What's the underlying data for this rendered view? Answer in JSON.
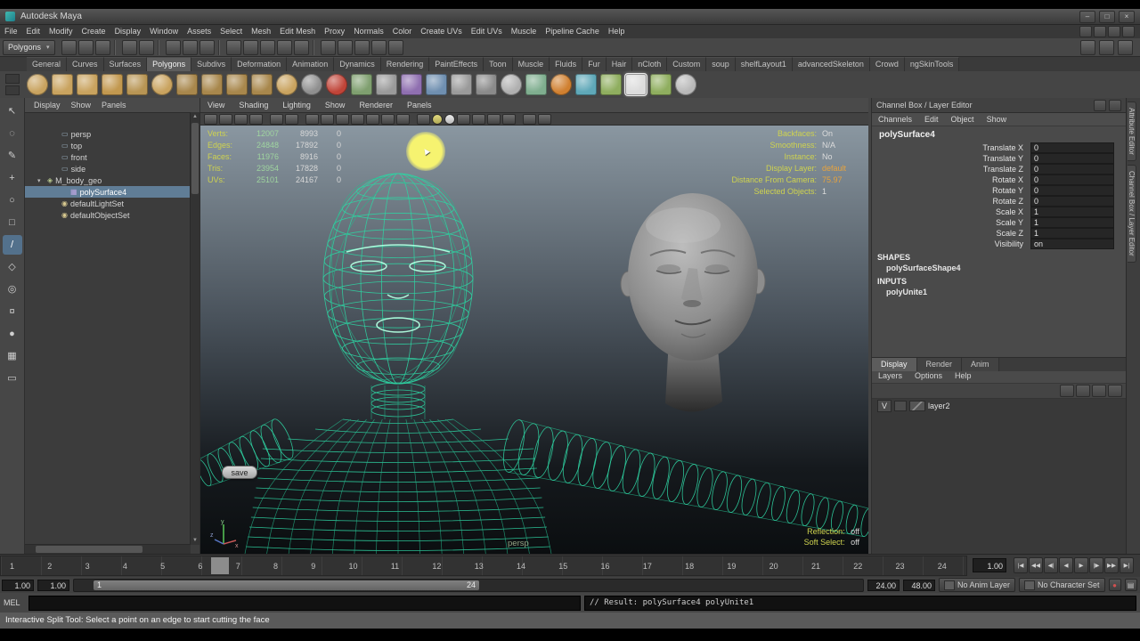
{
  "window": {
    "title": "Autodesk Maya",
    "controls": [
      "–",
      "□",
      "×"
    ]
  },
  "menu_bar": [
    "File",
    "Edit",
    "Modify",
    "Create",
    "Display",
    "Window",
    "Assets",
    "Select",
    "Mesh",
    "Edit Mesh",
    "Proxy",
    "Normals",
    "Color",
    "Create UVs",
    "Edit UVs",
    "Muscle",
    "Pipeline Cache",
    "Help"
  ],
  "status_line": {
    "menu_set": "Polygons",
    "icons": [
      {
        "name": "new-scene"
      },
      {
        "name": "open-scene"
      },
      {
        "name": "save-scene"
      },
      {
        "name": "separator",
        "cls": "sep"
      },
      {
        "name": "undo"
      },
      {
        "name": "redo"
      },
      {
        "name": "separator",
        "cls": "sep"
      },
      {
        "name": "select-by-hierarchy"
      },
      {
        "name": "select-by-object"
      },
      {
        "name": "select-by-component"
      },
      {
        "name": "separator",
        "cls": "sep"
      },
      {
        "name": "snap-to-grid"
      },
      {
        "name": "snap-to-curve"
      },
      {
        "name": "snap-to-point"
      },
      {
        "name": "snap-to-view-plane"
      },
      {
        "name": "make-live"
      },
      {
        "name": "separator",
        "cls": "sep"
      },
      {
        "name": "construction-history"
      },
      {
        "name": "open-render-view"
      },
      {
        "name": "render-current-frame"
      },
      {
        "name": "ipr-render"
      },
      {
        "name": "render-settings"
      }
    ],
    "right_icons": [
      {
        "name": "show-attribute-editor"
      },
      {
        "name": "show-tool-settings"
      },
      {
        "name": "show-channel-box"
      }
    ]
  },
  "shelf": {
    "tabs": [
      {
        "label": "General"
      },
      {
        "label": "Curves"
      },
      {
        "label": "Surfaces"
      },
      {
        "label": "Polygons",
        "cls": "active"
      },
      {
        "label": "Subdivs"
      },
      {
        "label": "Deformation"
      },
      {
        "label": "Animation"
      },
      {
        "label": "Dynamics"
      },
      {
        "label": "Rendering"
      },
      {
        "label": "PaintEffects"
      },
      {
        "label": "Toon"
      },
      {
        "label": "Muscle"
      },
      {
        "label": "Fluids"
      },
      {
        "label": "Fur"
      },
      {
        "label": "Hair"
      },
      {
        "label": "nCloth"
      },
      {
        "label": "Custom"
      },
      {
        "label": "soup"
      },
      {
        "label": "shelfLayout1"
      },
      {
        "label": "advancedSkeleton"
      },
      {
        "label": "Crowd"
      },
      {
        "label": "ngSkinTools"
      }
    ],
    "icons": [
      {
        "name": "poly-sphere",
        "color": "#c9a35f",
        "cls": "round"
      },
      {
        "name": "poly-cube",
        "color": "#c9a35f"
      },
      {
        "name": "poly-cylinder",
        "color": "#c9a35f"
      },
      {
        "name": "poly-cone",
        "color": "#c2984f"
      },
      {
        "name": "poly-plane",
        "color": "#b89554"
      },
      {
        "name": "poly-torus",
        "color": "#c9a35f",
        "cls": "round"
      },
      {
        "name": "poly-prism",
        "color": "#a8874c"
      },
      {
        "name": "poly-pyramid",
        "color": "#a8874c"
      },
      {
        "name": "poly-pipe",
        "color": "#a8874c"
      },
      {
        "name": "poly-helix",
        "color": "#a8874c"
      },
      {
        "name": "poly-soccer-ball",
        "color": "#c9a35f",
        "cls": "round"
      },
      {
        "name": "poly-platonic",
        "color": "#8f8f8f",
        "cls": "round"
      },
      {
        "name": "smooth",
        "color": "#c04438",
        "cls": "round"
      },
      {
        "name": "add-divisions",
        "color": "#7f9f6f"
      },
      {
        "name": "extrude",
        "color": "#9a9a9a"
      },
      {
        "name": "bevel",
        "color": "#8f6fb0"
      },
      {
        "name": "bridge",
        "color": "#6f8fb0"
      },
      {
        "name": "combine",
        "color": "#9a9a9a"
      },
      {
        "name": "separate",
        "color": "#8a8a8a"
      },
      {
        "name": "boolean-union",
        "color": "#b0b0b0",
        "cls": "round"
      },
      {
        "name": "mirror-geometry",
        "color": "#7fae8f"
      },
      {
        "name": "merge-vertices",
        "color": "#d08030",
        "cls": "round"
      },
      {
        "name": "target-weld",
        "color": "#5fa8b8"
      },
      {
        "name": "insert-edge-loop",
        "color": "#8fae5f"
      },
      {
        "name": "interactive-split-tool",
        "color": "#dcdcdc",
        "cls": "active"
      },
      {
        "name": "offset-edge-loop",
        "color": "#8fae5f"
      },
      {
        "name": "sculpt-geometry",
        "color": "#b8b8b8",
        "cls": "round"
      }
    ]
  },
  "toolbox": [
    {
      "name": "select-tool",
      "glyph": "↖"
    },
    {
      "name": "lasso-tool",
      "glyph": "◌"
    },
    {
      "name": "paint-select-tool",
      "glyph": "✎"
    },
    {
      "name": "move-tool",
      "glyph": "+"
    },
    {
      "name": "rotate-tool",
      "glyph": "○"
    },
    {
      "name": "scale-tool",
      "glyph": "□"
    },
    {
      "name": "interactive-split-tool-slot",
      "glyph": "/",
      "cls": "active"
    },
    {
      "name": "show-manipulator-tool",
      "glyph": "◇"
    },
    {
      "name": "soft-modification-tool",
      "glyph": "◎"
    },
    {
      "name": "universal-manipulator",
      "glyph": "¤"
    },
    {
      "name": "sculpt-tool",
      "glyph": "●"
    },
    {
      "name": "select-similar-tool",
      "glyph": "▦"
    },
    {
      "name": "layout-single-pane",
      "glyph": "▭"
    }
  ],
  "outliner": {
    "menus": [
      "Display",
      "Show",
      "Panels"
    ],
    "items": [
      {
        "label": "persp",
        "icon": "▭",
        "cls": "cam",
        "indent": 30
      },
      {
        "label": "top",
        "icon": "▭",
        "cls": "cam",
        "indent": 30
      },
      {
        "label": "front",
        "icon": "▭",
        "cls": "cam",
        "indent": 30
      },
      {
        "label": "side",
        "icon": "▭",
        "cls": "cam",
        "indent": 30
      },
      {
        "label": "M_body_geo",
        "icon": "◈",
        "cls": "geo",
        "indent": 14,
        "arrow": "▾"
      },
      {
        "label": "polySurface4",
        "icon": "▦",
        "cls": "mesh selected",
        "indent": 40
      },
      {
        "label": "defaultLightSet",
        "icon": "◉",
        "cls": "set",
        "indent": 30
      },
      {
        "label": "defaultObjectSet",
        "icon": "◉",
        "cls": "set",
        "indent": 30
      }
    ]
  },
  "viewport": {
    "menus": [
      "View",
      "Shading",
      "Lighting",
      "Show",
      "Renderer",
      "Panels"
    ],
    "toolbar_icons": [
      {
        "name": "select-camera"
      },
      {
        "name": "lock-camera"
      },
      {
        "name": "camera-attributes"
      },
      {
        "name": "bookmarks"
      },
      {
        "name": "separator",
        "cls": "sep"
      },
      {
        "name": "image-plane"
      },
      {
        "name": "two-d-pan-zoom"
      },
      {
        "name": "separator",
        "cls": "sep"
      },
      {
        "name": "grid"
      },
      {
        "name": "film-gate"
      },
      {
        "name": "resolution-gate"
      },
      {
        "name": "gate-mask"
      },
      {
        "name": "field-chart"
      },
      {
        "name": "safe-action"
      },
      {
        "name": "safe-title"
      },
      {
        "name": "separator",
        "cls": "sep"
      },
      {
        "name": "wireframe-mode"
      },
      {
        "name": "smooth-shade-mode",
        "cls": "round",
        "color": "#ddd46a"
      },
      {
        "name": "textured-mode",
        "cls": "round",
        "color": "#e8e8e8"
      },
      {
        "name": "use-all-lights"
      },
      {
        "name": "shadows"
      },
      {
        "name": "screen-space-ao"
      },
      {
        "name": "motion-blur"
      },
      {
        "name": "separator",
        "cls": "sep"
      },
      {
        "name": "xray"
      },
      {
        "name": "isolate-select"
      }
    ],
    "hud_left": [
      {
        "label": "Verts:",
        "a": "12007",
        "b": "8993",
        "c": "0"
      },
      {
        "label": "Edges:",
        "a": "24848",
        "b": "17892",
        "c": "0"
      },
      {
        "label": "Faces:",
        "a": "11976",
        "b": "8916",
        "c": "0"
      },
      {
        "label": "Tris:",
        "a": "23954",
        "b": "17828",
        "c": "0"
      },
      {
        "label": "UVs:",
        "a": "25101",
        "b": "24167",
        "c": "0"
      }
    ],
    "hud_right": [
      {
        "label": "Backfaces:",
        "value": "On"
      },
      {
        "label": "Smoothness:",
        "value": "N/A"
      },
      {
        "label": "Instance:",
        "value": "No"
      },
      {
        "label": "Display Layer:",
        "value": "default",
        "cls": "orange"
      },
      {
        "label": "Distance From Camera:",
        "value": "75.97",
        "cls": "orange"
      },
      {
        "label": "Selected Objects:",
        "value": "1"
      }
    ],
    "hud_bottom_right": [
      {
        "label": "Reflection:",
        "value": "off"
      },
      {
        "label": "Soft Select:",
        "value": "off"
      }
    ],
    "camera_label": "persp",
    "save_label": "save",
    "axis": {
      "x": "x",
      "y": "y",
      "z": "z"
    }
  },
  "channel_box": {
    "dock_title": "Channel Box / Layer Editor",
    "menus": [
      "Channels",
      "Edit",
      "Object",
      "Show"
    ],
    "object_name": "polySurface4",
    "attributes": [
      {
        "name": "Translate X",
        "value": "0"
      },
      {
        "name": "Translate Y",
        "value": "0"
      },
      {
        "name": "Translate Z",
        "value": "0"
      },
      {
        "name": "Rotate X",
        "value": "0"
      },
      {
        "name": "Rotate Y",
        "value": "0"
      },
      {
        "name": "Rotate Z",
        "value": "0"
      },
      {
        "name": "Scale X",
        "value": "1"
      },
      {
        "name": "Scale Y",
        "value": "1"
      },
      {
        "name": "Scale Z",
        "value": "1"
      },
      {
        "name": "Visibility",
        "value": "on"
      }
    ],
    "shapes_heading": "SHAPES",
    "shape_name": "polySurfaceShape4",
    "inputs_heading": "INPUTS",
    "input_name": "polyUnite1"
  },
  "layer_editor": {
    "tabs": [
      {
        "label": "Display",
        "cls": "active"
      },
      {
        "label": "Render"
      },
      {
        "label": "Anim"
      }
    ],
    "menus": [
      "Layers",
      "Options",
      "Help"
    ],
    "layers": [
      {
        "visibility": "V",
        "name": "layer2"
      }
    ]
  },
  "dock_tabs": [
    {
      "label": "Attribute Editor"
    },
    {
      "label": "Channel Box / Layer Editor"
    }
  ],
  "timeline": {
    "ticks": [
      "1",
      "2",
      "3",
      "4",
      "5",
      "6",
      "7",
      "8",
      "9",
      "10",
      "11",
      "12",
      "13",
      "14",
      "15",
      "16",
      "17",
      "18",
      "19",
      "20",
      "21",
      "22",
      "23",
      "24"
    ],
    "current_time": "1.00"
  },
  "range_bar": {
    "animation_start": "1.00",
    "playback_start": "1.00",
    "range_start_label": "1",
    "range_end_label": "24",
    "playback_end": "24.00",
    "animation_end": "48.00",
    "anim_layer": "No Anim Layer",
    "character_set": "No Character Set"
  },
  "playback": [
    {
      "name": "go-to-start",
      "glyph": "|◀"
    },
    {
      "name": "step-back-frame",
      "glyph": "◀◀"
    },
    {
      "name": "step-back-key",
      "glyph": "◀|"
    },
    {
      "name": "play-backwards",
      "glyph": "◀"
    },
    {
      "name": "play-forwards",
      "glyph": "▶"
    },
    {
      "name": "step-forward-key",
      "glyph": "|▶"
    },
    {
      "name": "step-forward-frame",
      "glyph": "▶▶"
    },
    {
      "name": "go-to-end",
      "glyph": "▶|"
    }
  ],
  "command_line": {
    "label": "MEL",
    "result": "// Result: polySurface4 polyUnite1"
  },
  "help_line": "Interactive Split Tool: Select a point on an edge to start cutting the face"
}
